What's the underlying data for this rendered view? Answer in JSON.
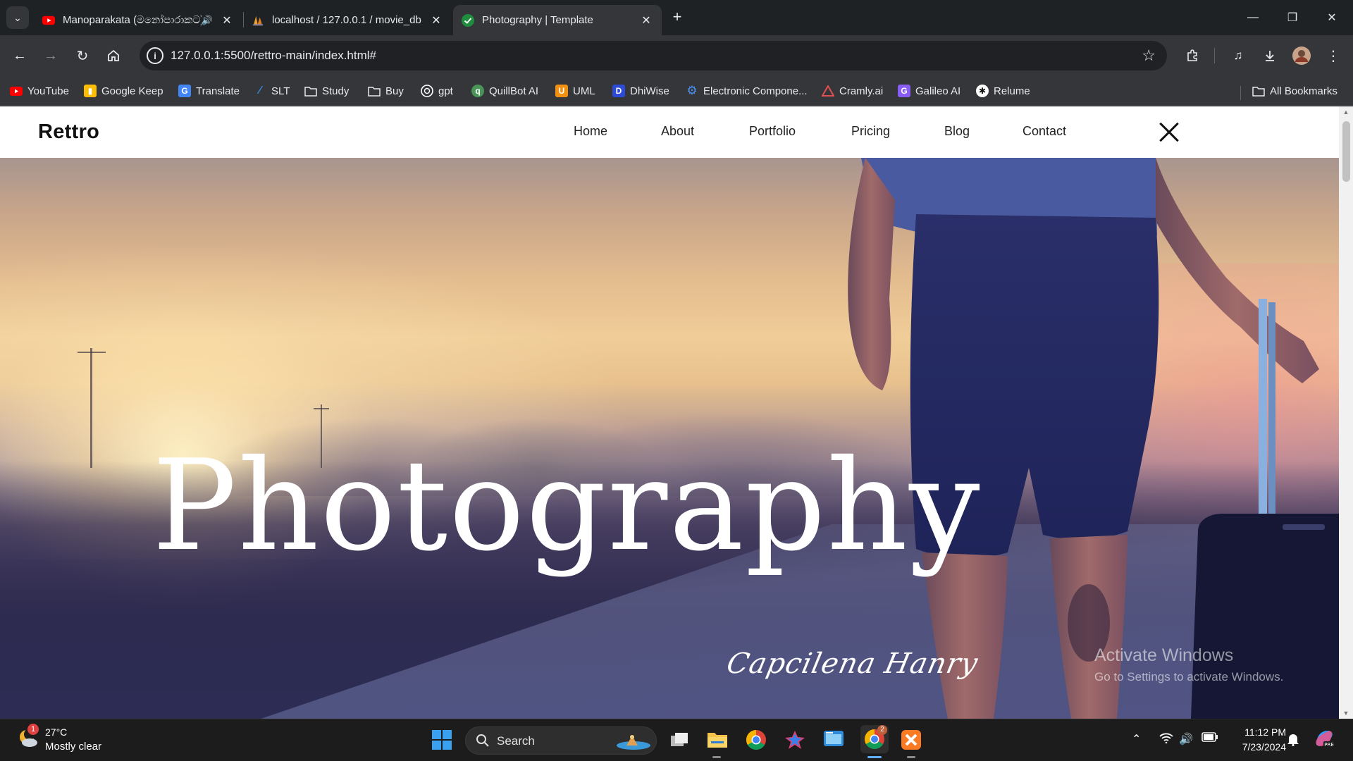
{
  "browser": {
    "tabs": [
      {
        "title": "Manoparakata (මනෝපාරාකට)",
        "favicon": "youtube-icon",
        "audio": true,
        "active": false
      },
      {
        "title": "localhost / 127.0.0.1 / movie_db",
        "favicon": "phpmyadmin-icon",
        "audio": false,
        "active": false
      },
      {
        "title": "Photography | Template",
        "favicon": "check-circle-icon",
        "audio": false,
        "active": true
      }
    ],
    "url": "127.0.0.1:5500/rettro-main/index.html#",
    "bookmarks": [
      {
        "label": "YouTube",
        "icon": "youtube-icon",
        "color": "#ff0000"
      },
      {
        "label": "Google Keep",
        "icon": "keep-icon",
        "color": "#fbbc04"
      },
      {
        "label": "Translate",
        "icon": "translate-icon",
        "color": "#4285f4"
      },
      {
        "label": "SLT",
        "icon": "slt-icon",
        "color": "#3b8ad9"
      },
      {
        "label": "Study",
        "icon": "folder-icon",
        "color": "#e8eaed"
      },
      {
        "label": "Buy",
        "icon": "folder-icon",
        "color": "#e8eaed"
      },
      {
        "label": "gpt",
        "icon": "openai-icon",
        "color": "#ffffff"
      },
      {
        "label": "QuillBot AI",
        "icon": "quillbot-icon",
        "color": "#499557"
      },
      {
        "label": "UML",
        "icon": "uml-icon",
        "color": "#f29111"
      },
      {
        "label": "DhiWise",
        "icon": "dhiwise-icon",
        "color": "#2d4bd6"
      },
      {
        "label": "Electronic Compone...",
        "icon": "gear-icon",
        "color": "#4a8ff0"
      },
      {
        "label": "Cramly.ai",
        "icon": "cramly-icon",
        "color": "#e05050"
      },
      {
        "label": "Galileo AI",
        "icon": "galileo-icon",
        "color": "#8a5cf6"
      },
      {
        "label": "Relume",
        "icon": "relume-icon",
        "color": "#ffffff"
      }
    ],
    "all_bookmarks": "All Bookmarks"
  },
  "site": {
    "logo": "Rettro",
    "nav": [
      "Home",
      "About",
      "Portfolio",
      "Pricing",
      "Blog",
      "Contact"
    ],
    "hero_title": "Photography",
    "hero_signature": "Capcilena Hanry"
  },
  "watermark": {
    "title": "Activate Windows",
    "subtitle": "Go to Settings to activate Windows."
  },
  "taskbar": {
    "weather_badge": "1",
    "temperature": "27°C",
    "condition": "Mostly clear",
    "search_label": "Search",
    "time": "11:12 PM",
    "date": "7/23/2024",
    "chrome_badge": "2"
  }
}
